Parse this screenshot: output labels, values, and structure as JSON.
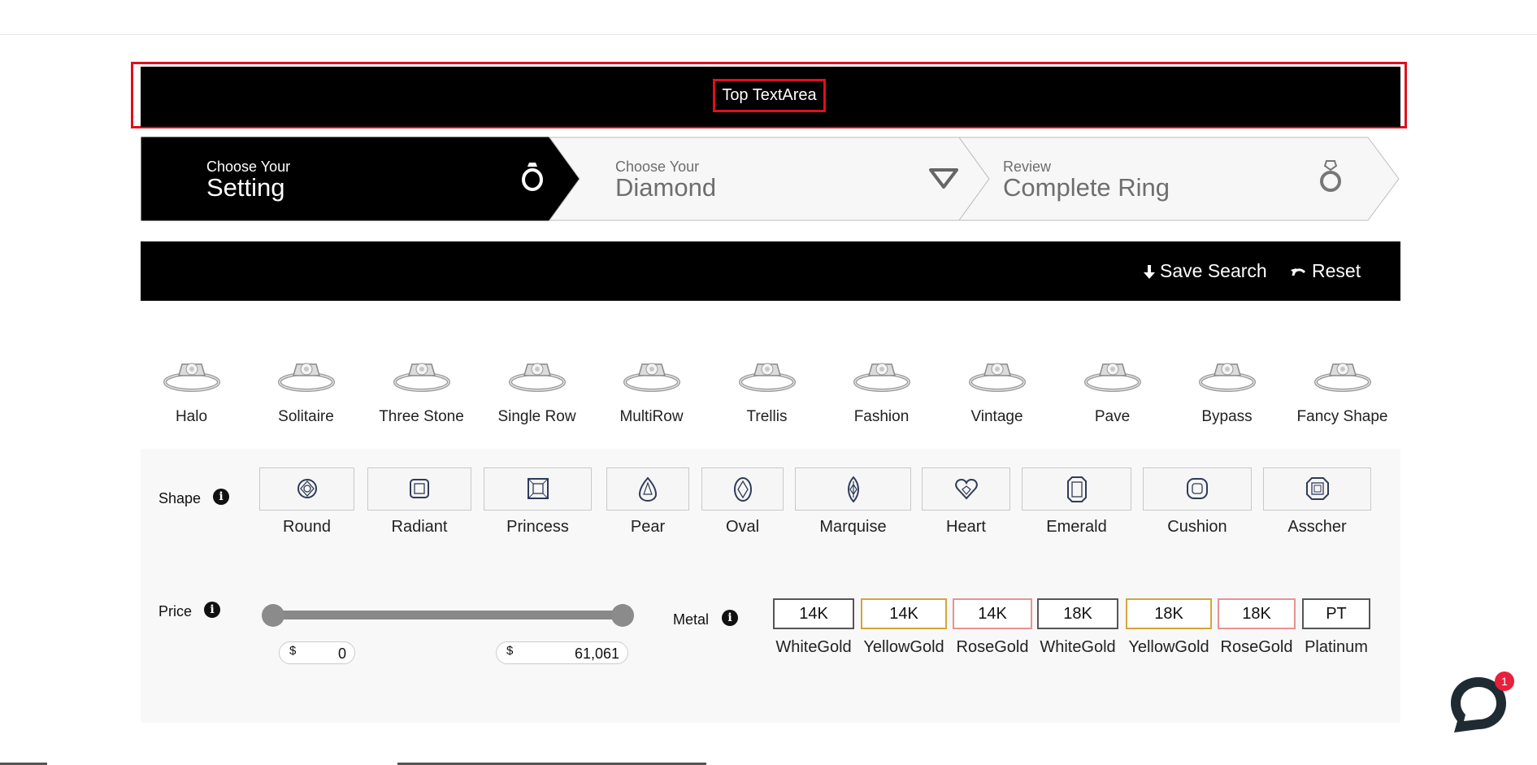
{
  "top_text": "Top TextArea",
  "steps": [
    {
      "small": "Choose Your",
      "big": "Setting",
      "icon": "ring-icon",
      "active": true
    },
    {
      "small": "Choose Your",
      "big": "Diamond",
      "icon": "diamond-icon",
      "active": false
    },
    {
      "small": "Review",
      "big": "Complete Ring",
      "icon": "complete-ring-icon",
      "active": false
    }
  ],
  "toolbar": {
    "save_label": "Save Search",
    "reset_label": "Reset"
  },
  "styles": [
    "Halo",
    "Solitaire",
    "Three Stone",
    "Single Row",
    "MultiRow",
    "Trellis",
    "Fashion",
    "Vintage",
    "Pave",
    "Bypass",
    "Fancy Shape"
  ],
  "filters": {
    "shape_label": "Shape",
    "price_label": "Price",
    "metal_label": "Metal",
    "shapes": [
      "Round",
      "Radiant",
      "Princess",
      "Pear",
      "Oval",
      "Marquise",
      "Heart",
      "Emerald",
      "Cushion",
      "Asscher"
    ],
    "price": {
      "currency": "$",
      "min": "0",
      "max": "61,061"
    },
    "metals": [
      {
        "karat": "14K",
        "name": "WhiteGold",
        "color": "#555555"
      },
      {
        "karat": "14K",
        "name": "YellowGold",
        "color": "#d4a53a"
      },
      {
        "karat": "14K",
        "name": "RoseGold",
        "color": "#e99292"
      },
      {
        "karat": "18K",
        "name": "WhiteGold",
        "color": "#555555"
      },
      {
        "karat": "18K",
        "name": "YellowGold",
        "color": "#d4a53a"
      },
      {
        "karat": "18K",
        "name": "RoseGold",
        "color": "#e99292"
      },
      {
        "karat": "PT",
        "name": "Platinum",
        "color": "#555555"
      }
    ]
  },
  "chat": {
    "badge": "1"
  }
}
